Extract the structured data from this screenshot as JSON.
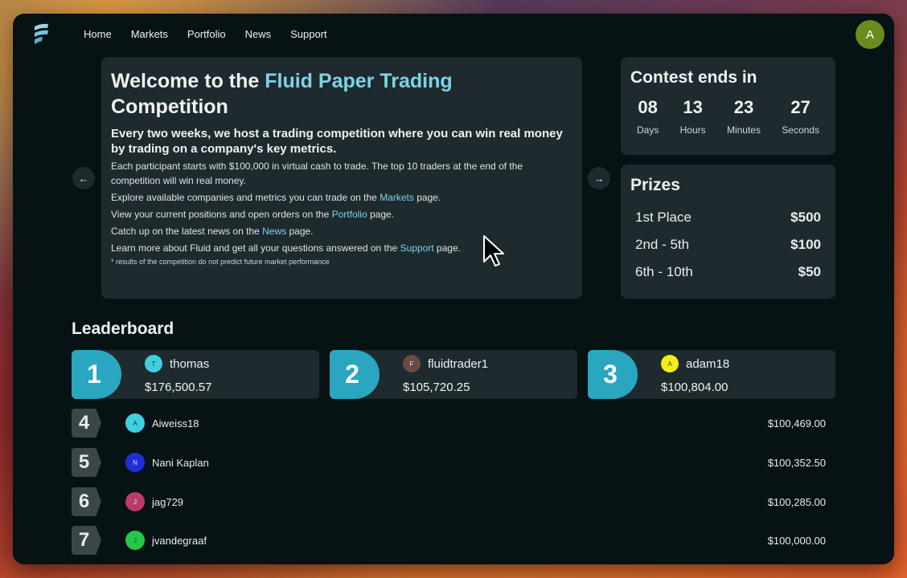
{
  "nav": {
    "items": [
      "Home",
      "Markets",
      "Portfolio",
      "News",
      "Support"
    ]
  },
  "user": {
    "initial": "A",
    "color": "#6c8a1e"
  },
  "welcome": {
    "title_prefix": "Welcome to the ",
    "title_accent": "Fluid Paper Trading",
    "title_suffix": "Competition",
    "subtitle": "Every two weeks, we host a trading competition where you can win real money by trading on a company's key metrics.",
    "p1": "Each participant starts with $100,000 in virtual cash to trade. The top 10 traders at the end of the competition will win real money.",
    "p2_pre": "Explore available companies and metrics you can trade on the ",
    "p2_link": "Markets",
    "p2_post": " page.",
    "p3_pre": "View your current positions and open orders on the ",
    "p3_link": "Portfolio",
    "p3_post": " page.",
    "p4_pre": "Catch up on the latest news on the ",
    "p4_link": "News",
    "p4_post": " page.",
    "p5_pre": "Learn more about Fluid and get all your questions answered on the ",
    "p5_link": "Support",
    "p5_post": " page.",
    "fine_print": "* results of the competition do not predict future market performance"
  },
  "contest": {
    "title": "Contest ends in",
    "days": "08",
    "days_label": "Days",
    "hours": "13",
    "hours_label": "Hours",
    "minutes": "23",
    "minutes_label": "Minutes",
    "seconds": "27",
    "seconds_label": "Seconds"
  },
  "prizes": {
    "title": "Prizes",
    "rows": [
      {
        "place": "1st Place",
        "amount": "$500"
      },
      {
        "place": "2nd - 5th",
        "amount": "$100"
      },
      {
        "place": "6th - 10th",
        "amount": "$50"
      }
    ]
  },
  "leaderboard": {
    "title": "Leaderboard",
    "top": [
      {
        "rank": "1",
        "initial": "T",
        "name": "thomas",
        "amount": "$176,500.57",
        "color": "#3fd0e0"
      },
      {
        "rank": "2",
        "initial": "F",
        "name": "fluidtrader1",
        "amount": "$105,720.25",
        "color": "#6a4a42"
      },
      {
        "rank": "3",
        "initial": "A",
        "name": "adam18",
        "amount": "$100,804.00",
        "color": "#f2ec1a"
      }
    ],
    "rows": [
      {
        "rank": "4",
        "initial": "A",
        "name": "Aiweiss18",
        "amount": "$100,469.00",
        "color": "#3fd0e0"
      },
      {
        "rank": "5",
        "initial": "N",
        "name": "Nani Kaplan",
        "amount": "$100,352.50",
        "color": "#1f2fd8"
      },
      {
        "rank": "6",
        "initial": "J",
        "name": "jag729",
        "amount": "$100,285.00",
        "color": "#b83c6a"
      },
      {
        "rank": "7",
        "initial": "J",
        "name": "jvandegraaf",
        "amount": "$100,000.00",
        "color": "#22c94a"
      }
    ]
  }
}
